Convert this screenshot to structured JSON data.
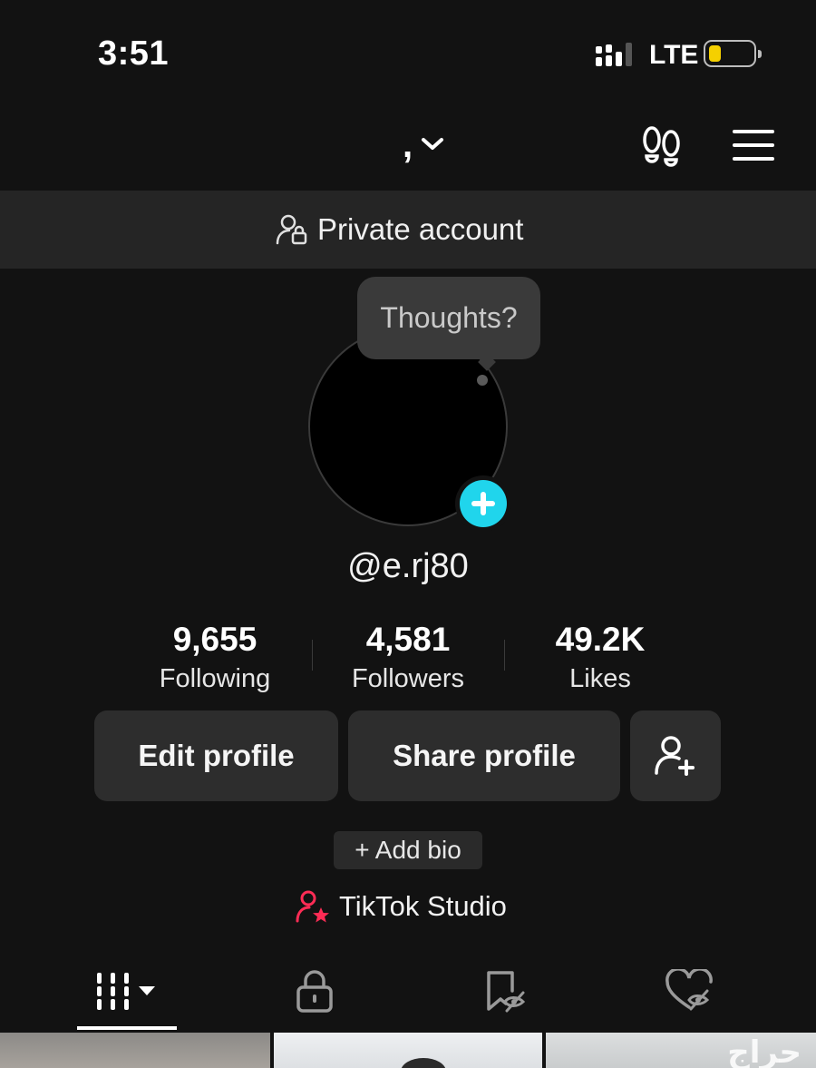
{
  "status_bar": {
    "time": "3:51",
    "network": "LTE",
    "battery_level": 0.2,
    "battery_color": "#f5d000"
  },
  "top_nav": {
    "username": ",",
    "footprints_icon": "footprints-icon",
    "menu_icon": "hamburger-menu-icon"
  },
  "banner": {
    "text": "Private account",
    "icon": "private-account-icon"
  },
  "avatar": {
    "bubble_text": "Thoughts?",
    "add_icon": "plus-icon",
    "add_color": "#20d5ec"
  },
  "profile": {
    "handle": "@e.rj80"
  },
  "stats": [
    {
      "value": "9,655",
      "label": "Following"
    },
    {
      "value": "4,581",
      "label": "Followers"
    },
    {
      "value": "49.2K",
      "label": "Likes"
    }
  ],
  "buttons": {
    "edit_profile": "Edit profile",
    "share_profile": "Share profile",
    "add_friend_icon": "add-friend-icon"
  },
  "bio": {
    "add_bio": "+ Add bio"
  },
  "studio": {
    "label": "TikTok Studio",
    "icon_color": "#fe2c55"
  },
  "tabs": [
    {
      "name": "videos",
      "icon": "grid-icon",
      "active": true
    },
    {
      "name": "private",
      "icon": "lock-icon",
      "active": false
    },
    {
      "name": "saved",
      "icon": "hidden-bookmark-icon",
      "active": false
    },
    {
      "name": "liked",
      "icon": "hidden-heart-icon",
      "active": false
    }
  ],
  "watermark": "حراج"
}
